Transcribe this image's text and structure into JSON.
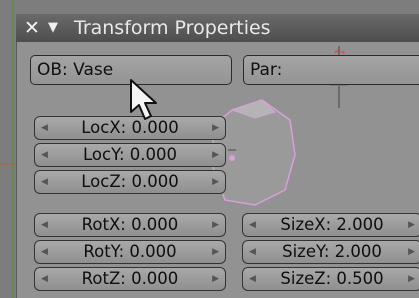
{
  "panel": {
    "title": "Transform Properties",
    "object_field": "OB: Vase",
    "parent_field": "Par:"
  },
  "location": [
    {
      "label": "LocX: 0.000"
    },
    {
      "label": "LocY: 0.000"
    },
    {
      "label": "LocZ: 0.000"
    }
  ],
  "rotation": [
    {
      "label": "RotX: 0.000"
    },
    {
      "label": "RotY: 0.000"
    },
    {
      "label": "RotZ: 0.000"
    }
  ],
  "size": [
    {
      "label": "SizeX: 2.000"
    },
    {
      "label": "SizeY: 2.000"
    },
    {
      "label": "SizeZ: 0.500"
    }
  ],
  "icons": {
    "close": "close-icon",
    "collapse": "collapse-triangle-icon",
    "arrow_left": "arrow-left-icon",
    "arrow_right": "arrow-right-icon"
  },
  "colors": {
    "panel_bg": "#929292",
    "titlebar": "#5a5a5a",
    "mesh_outline": "#d8a0d8",
    "x_axis": "#b0604a",
    "y_axis": "#5a8f4a"
  }
}
